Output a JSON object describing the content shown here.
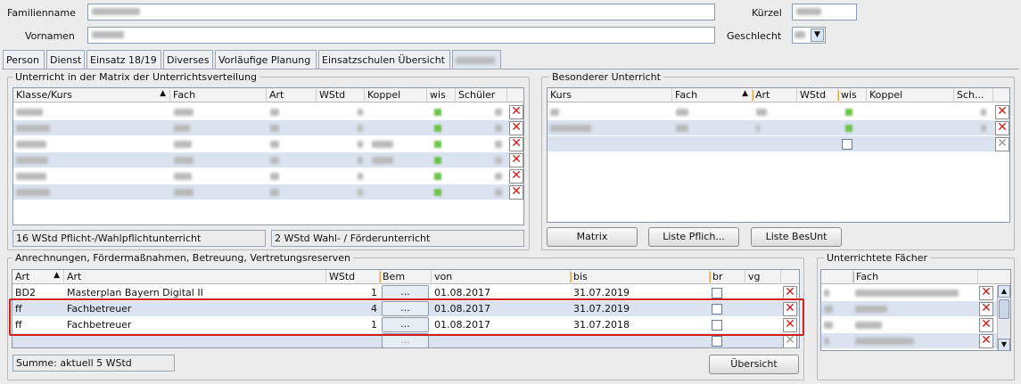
{
  "header": {
    "familienname_label": "Familienname",
    "vornamen_label": "Vornamen",
    "kuerzel_label": "Kürzel",
    "geschlecht_label": "Geschlecht"
  },
  "tabs": [
    {
      "label": "Person"
    },
    {
      "label": "Dienst"
    },
    {
      "label": "Einsatz 18/19"
    },
    {
      "label": "Diverses"
    },
    {
      "label": "Vorläufige Planung"
    },
    {
      "label": "Einsatzschulen Übersicht"
    }
  ],
  "matrix": {
    "title": "Unterricht in der Matrix der Unterrichtsverteilung",
    "columns": [
      "Klasse/Kurs",
      "Fach",
      "Art",
      "WStd",
      "Koppel",
      "wis",
      "Schüler"
    ],
    "summary_left": "16 WStd Pflicht-/Wahlpflichtunterricht",
    "summary_right": "2 WStd Wahl- / Förderunterricht"
  },
  "besonderer": {
    "title": "Besonderer Unterricht",
    "columns": [
      "Kurs",
      "Fach",
      "Art",
      "WStd",
      "wis",
      "Koppel",
      "Sch..."
    ],
    "buttons": {
      "matrix": "Matrix",
      "liste_pflicht": "Liste Pflich...",
      "liste_besunt": "Liste BesUnt"
    }
  },
  "anrechnungen": {
    "title": "Anrechnungen, Fördermaßnahmen, Betreuung, Vertretungsreserven",
    "columns": [
      "Art",
      "Art",
      "WStd",
      "Bem",
      "von",
      "bis",
      "br",
      "vg"
    ],
    "rows": [
      {
        "art": "BD2",
        "bezeichnung": "Masterplan Bayern Digital II",
        "wstd": "1",
        "bem": "...",
        "von": "01.08.2017",
        "bis": "31.07.2019"
      },
      {
        "art": "ff",
        "bezeichnung": "Fachbetreuer",
        "wstd": "4",
        "bem": "...",
        "von": "01.08.2017",
        "bis": "31.07.2019"
      },
      {
        "art": "ff",
        "bezeichnung": "Fachbetreuer",
        "wstd": "1",
        "bem": "...",
        "von": "01.08.2017",
        "bis": "31.07.2018"
      }
    ],
    "empty_bem": "...",
    "summe": "Summe: aktuell 5 WStd",
    "uebersicht_button": "Übersicht"
  },
  "faecher": {
    "title": "Unterrichtete Fächer",
    "columns": [
      "Fach"
    ]
  },
  "icons": {
    "delete": "delete-x-icon",
    "dropdown": "chevron-down-icon",
    "scroll_up": "arrow-up-icon",
    "scroll_down": "arrow-down-icon"
  },
  "colors": {
    "highlight": "#d41f1f",
    "row_alt": "#dbe3f1",
    "delete": "#d21a1a"
  }
}
